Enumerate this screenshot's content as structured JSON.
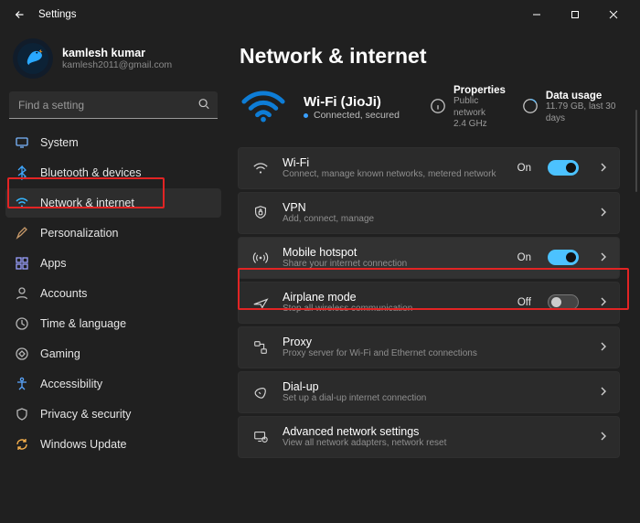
{
  "window": {
    "title": "Settings"
  },
  "profile": {
    "name": "kamlesh kumar",
    "email": "kamlesh2011@gmail.com"
  },
  "search": {
    "placeholder": "Find a setting"
  },
  "sidebar": {
    "items": [
      {
        "label": "System"
      },
      {
        "label": "Bluetooth & devices"
      },
      {
        "label": "Network & internet"
      },
      {
        "label": "Personalization"
      },
      {
        "label": "Apps"
      },
      {
        "label": "Accounts"
      },
      {
        "label": "Time & language"
      },
      {
        "label": "Gaming"
      },
      {
        "label": "Accessibility"
      },
      {
        "label": "Privacy & security"
      },
      {
        "label": "Windows Update"
      }
    ]
  },
  "page": {
    "title": "Network & internet"
  },
  "status": {
    "ssid": "Wi-Fi (JioJi)",
    "state": "Connected, secured",
    "properties": {
      "title": "Properties",
      "sub": "Public network\n2.4 GHz"
    },
    "usage": {
      "title": "Data usage",
      "sub": "11.79 GB, last 30 days"
    }
  },
  "rows": {
    "wifi": {
      "title": "Wi-Fi",
      "sub": "Connect, manage known networks, metered network",
      "state": "On"
    },
    "vpn": {
      "title": "VPN",
      "sub": "Add, connect, manage"
    },
    "hotspot": {
      "title": "Mobile hotspot",
      "sub": "Share your internet connection",
      "state": "On"
    },
    "airplane": {
      "title": "Airplane mode",
      "sub": "Stop all wireless communication",
      "state": "Off"
    },
    "proxy": {
      "title": "Proxy",
      "sub": "Proxy server for Wi-Fi and Ethernet connections"
    },
    "dialup": {
      "title": "Dial-up",
      "sub": "Set up a dial-up internet connection"
    },
    "advanced": {
      "title": "Advanced network settings",
      "sub": "View all network adapters, network reset"
    }
  }
}
